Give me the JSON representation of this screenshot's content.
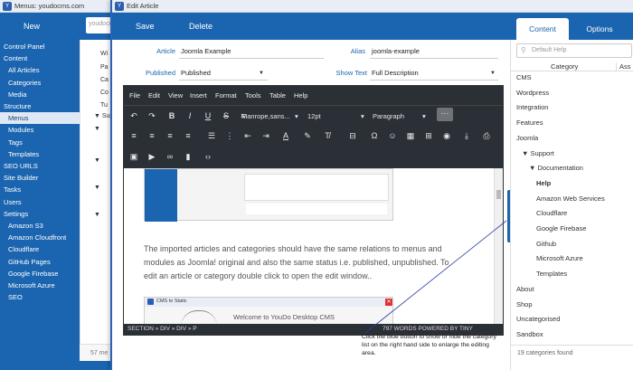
{
  "background_window": {
    "title": "Menus: youdocms.com",
    "new_label": "New",
    "search_value": "youdocms",
    "sidebar": [
      {
        "label": "Control Panel",
        "indent": false,
        "selected": false
      },
      {
        "label": "Content",
        "indent": false,
        "selected": false
      },
      {
        "label": "All Articles",
        "indent": true,
        "selected": false
      },
      {
        "label": "Categories",
        "indent": true,
        "selected": false
      },
      {
        "label": "Media",
        "indent": true,
        "selected": false
      },
      {
        "label": "Structure",
        "indent": false,
        "selected": false
      },
      {
        "label": "Menus",
        "indent": true,
        "selected": true
      },
      {
        "label": "Modules",
        "indent": true,
        "selected": false
      },
      {
        "label": "Tags",
        "indent": true,
        "selected": false
      },
      {
        "label": "Templates",
        "indent": true,
        "selected": false
      },
      {
        "label": "SEO URLS",
        "indent": false,
        "selected": false
      },
      {
        "label": "Site Builder",
        "indent": false,
        "selected": false
      },
      {
        "label": "Tasks",
        "indent": false,
        "selected": false
      },
      {
        "label": "Users",
        "indent": false,
        "selected": false
      },
      {
        "label": "Settings",
        "indent": false,
        "selected": false
      },
      {
        "label": "Amazon S3",
        "indent": true,
        "selected": false
      },
      {
        "label": "Amazon Cloudfront",
        "indent": true,
        "selected": false
      },
      {
        "label": "Cloudflare",
        "indent": true,
        "selected": false
      },
      {
        "label": "GitHub Pages",
        "indent": true,
        "selected": false
      },
      {
        "label": "Google Firebase",
        "indent": true,
        "selected": false
      },
      {
        "label": "Microsoft Azure",
        "indent": true,
        "selected": false
      },
      {
        "label": "SEO",
        "indent": true,
        "selected": false
      }
    ],
    "list_items": [
      "Wi",
      "Pa",
      "Ca",
      "Co",
      "Tu",
      "▼ Sup",
      "▼",
      "▼",
      "▼",
      "▼"
    ],
    "footer": "57 me"
  },
  "dialog": {
    "title": "Edit Article",
    "save_label": "Save",
    "delete_label": "Delete",
    "tab_content": "Content",
    "tab_options": "Options",
    "form": {
      "article_label": "Article",
      "article_value": "Joomla Example",
      "alias_label": "Alias",
      "alias_value": "joomla-example",
      "published_label": "Published",
      "published_value": "Published",
      "showtext_label": "Show Text",
      "showtext_value": "Full Description"
    },
    "editor": {
      "menu": [
        "File",
        "Edit",
        "View",
        "Insert",
        "Format",
        "Tools",
        "Table",
        "Help"
      ],
      "font_family": "Manrope,sans...",
      "font_size": "12pt",
      "block_format": "Paragraph",
      "body_lines": [
        "The imported articles and categories should have the same relations to menus and",
        "modules as Joomla! original and also the same status i.e. published, unpublished. To",
        "edit an article or category double click to open the edit window.."
      ],
      "preview_text": "Welcome to YouDo Desktop CMS",
      "preview_title": "CMS to Static",
      "path": "SECTION » DIV » DIV » P",
      "words": "797 WORDS POWERED BY TINY"
    },
    "callout": "Click the blue button to show or hide the category list on the right hand side to enlarge the editing area."
  },
  "right_panel": {
    "search_placeholder": "Default Help",
    "col_category": "Category",
    "col_assoc": "Ass",
    "categories": [
      {
        "label": "CMS",
        "level": 0
      },
      {
        "label": "Wordpress",
        "level": 0
      },
      {
        "label": "Integration",
        "level": 0
      },
      {
        "label": "Features",
        "level": 0
      },
      {
        "label": "Joomla",
        "level": 0
      },
      {
        "label": "▼ Support",
        "level": 1
      },
      {
        "label": "▼ Documentation",
        "level": 2
      },
      {
        "label": "Help",
        "level": 3,
        "bold": true
      },
      {
        "label": "Amazon Web Services",
        "level": 3
      },
      {
        "label": "Cloudflare",
        "level": 3
      },
      {
        "label": "Google Firebase",
        "level": 3
      },
      {
        "label": "Github",
        "level": 3
      },
      {
        "label": "Microsoft Azure",
        "level": 3
      },
      {
        "label": "Templates",
        "level": 3
      },
      {
        "label": "About",
        "level": 0
      },
      {
        "label": "Shop",
        "level": 0
      },
      {
        "label": "Uncategorised",
        "level": 0
      },
      {
        "label": "Sandbox",
        "level": 0
      }
    ],
    "footer": "19 categories found"
  },
  "colors": {
    "accent": "#1b65b0",
    "editor_dark": "#2b2f36"
  }
}
